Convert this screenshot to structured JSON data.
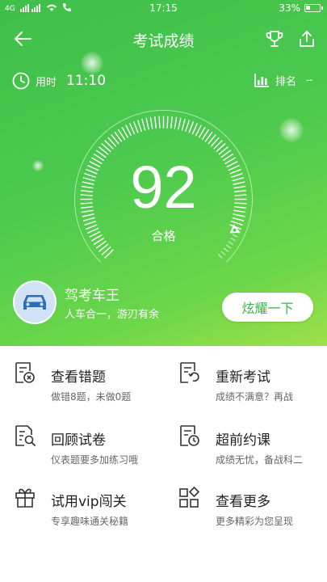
{
  "status_bar": {
    "signal_left": "4G",
    "time": "17:15",
    "battery": "33%",
    "battery_level": 0.33
  },
  "header": {
    "title": "考试成绩",
    "back_icon": "arrow-left-icon",
    "trophy_icon": "trophy-icon",
    "share_icon": "share-icon"
  },
  "meta": {
    "time_label": "用时",
    "time_value": "11:10",
    "rank_label": "排名",
    "rank_value": "–"
  },
  "result": {
    "score": "92",
    "grade": "合格",
    "gauge_fraction": 0.92
  },
  "user": {
    "name": "驾考车王",
    "motto": "人车合一，游刃有余",
    "share_button": "炫耀一下"
  },
  "menu": [
    {
      "title": "查看错题",
      "subtitle": "做错8题，未做0题",
      "icon": "wrong-questions-icon"
    },
    {
      "title": "重新考试",
      "subtitle": "成绩不满意？再战",
      "icon": "retake-exam-icon"
    },
    {
      "title": "回顾试卷",
      "subtitle": "仪表题要多加练习哦",
      "icon": "review-paper-icon"
    },
    {
      "title": "超前约课",
      "subtitle": "成绩无忧，备战科二",
      "icon": "book-class-icon"
    },
    {
      "title": "试用vip闯关",
      "subtitle": "专享趣味通关秘籍",
      "icon": "gift-icon"
    },
    {
      "title": "查看更多",
      "subtitle": "更多精彩为您呈现",
      "icon": "more-grid-icon"
    }
  ],
  "colors": {
    "brand_green": "#3bb34a",
    "hero_start": "#3fbf4a",
    "hero_end": "#9fe04a"
  }
}
